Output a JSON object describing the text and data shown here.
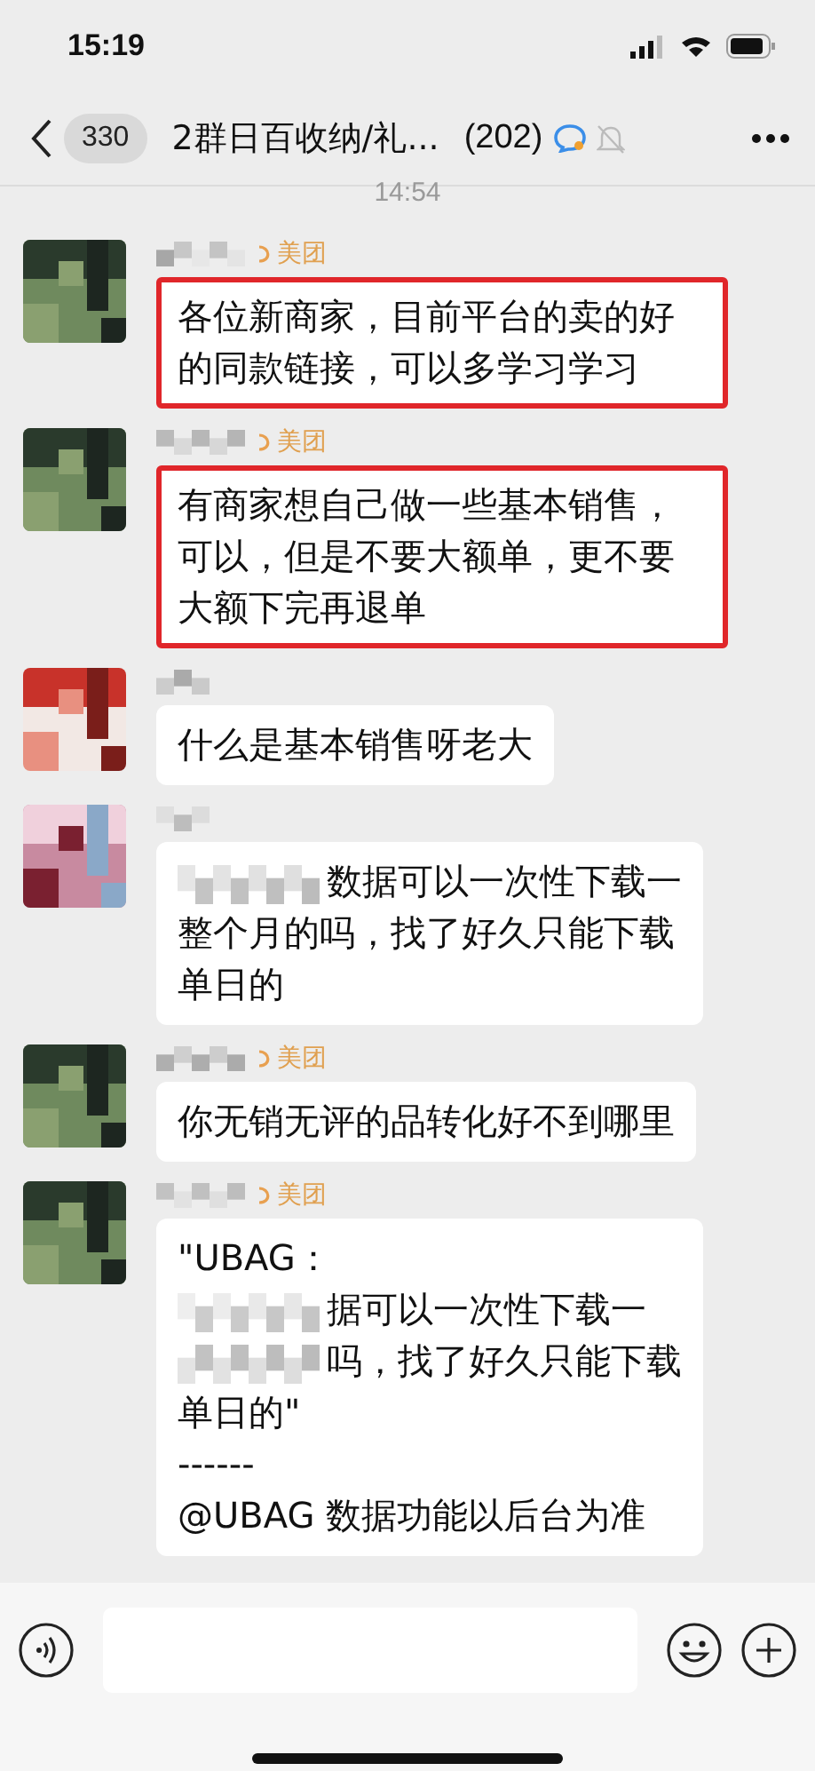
{
  "status_bar": {
    "time": "15:19"
  },
  "nav": {
    "back_count": "330",
    "title": "2群日百收纳/礼...",
    "member_count": "(202)",
    "muted": true
  },
  "timestamp": "14:54",
  "messages": [
    {
      "tag": "美团",
      "highlighted": true,
      "parts": [
        {
          "kind": "text",
          "text": "各位新商家，目前平台的卖的好的同款链接，可以多学习学习"
        }
      ]
    },
    {
      "tag": "美团",
      "highlighted": true,
      "parts": [
        {
          "kind": "text",
          "text": "有商家想自己做一些基本销售，可以，但是不要大额单，更不要大额下完再退单"
        }
      ]
    },
    {
      "highlighted": false,
      "parts": [
        {
          "kind": "text",
          "text": "什么是基本销售呀老大"
        }
      ]
    },
    {
      "highlighted": false,
      "parts": [
        {
          "kind": "mosaic"
        },
        {
          "kind": "text",
          "text": "数据可以一次性下载一"
        },
        {
          "kind": "break"
        },
        {
          "kind": "text",
          "text": "整个月的吗，找了好久只能下载"
        },
        {
          "kind": "break"
        },
        {
          "kind": "text",
          "text": "单日的"
        }
      ]
    },
    {
      "tag": "美团",
      "highlighted": false,
      "parts": [
        {
          "kind": "text",
          "text": "你无销无评的品转化好不到哪里"
        }
      ]
    },
    {
      "tag": "美团",
      "highlighted": false,
      "parts": [
        {
          "kind": "text",
          "text": "\"UBAG："
        },
        {
          "kind": "break"
        },
        {
          "kind": "mosaic"
        },
        {
          "kind": "text",
          "text": "据可以一次性下载一"
        },
        {
          "kind": "break"
        },
        {
          "kind": "mosaic"
        },
        {
          "kind": "text",
          "text": "吗，找了好久只能下载"
        },
        {
          "kind": "break"
        },
        {
          "kind": "text",
          "text": "单日的\""
        },
        {
          "kind": "break"
        },
        {
          "kind": "text",
          "text": "------"
        },
        {
          "kind": "break"
        },
        {
          "kind": "text",
          "text": "@UBAG 数据功能以后台为准"
        }
      ]
    }
  ]
}
